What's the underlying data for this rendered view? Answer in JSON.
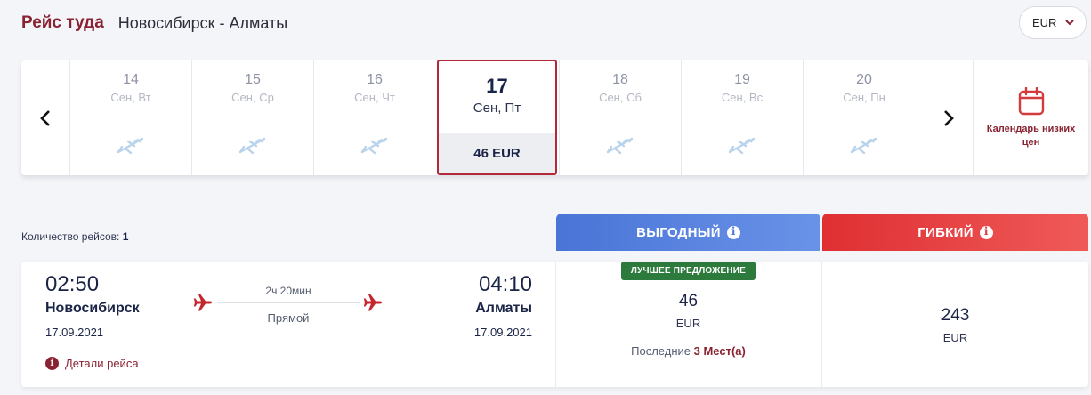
{
  "header": {
    "direction": "Рейс туда",
    "route": "Новосибирск - Алматы"
  },
  "currency": {
    "selected": "EUR",
    "icon": "chevron-down-icon"
  },
  "date_bar": {
    "prev_icon": "chevron-left-icon",
    "next_icon": "chevron-right-icon",
    "days": [
      {
        "num": "14",
        "weekday": "Сен, Вт",
        "price": null,
        "selected": false
      },
      {
        "num": "15",
        "weekday": "Сен, Ср",
        "price": null,
        "selected": false
      },
      {
        "num": "16",
        "weekday": "Сен, Чт",
        "price": null,
        "selected": false
      },
      {
        "num": "17",
        "weekday": "Сен, Пт",
        "price": "46 EUR",
        "selected": true
      },
      {
        "num": "18",
        "weekday": "Сен, Сб",
        "price": null,
        "selected": false
      },
      {
        "num": "19",
        "weekday": "Сен, Вс",
        "price": null,
        "selected": false
      },
      {
        "num": "20",
        "weekday": "Сен, Пн",
        "price": null,
        "selected": false
      }
    ],
    "low_price_calendar": {
      "label": "Календарь низких цен",
      "icon": "calendar-icon"
    }
  },
  "flights_count": {
    "label": "Количество рейсов:",
    "value": "1"
  },
  "fares": {
    "economy": {
      "label": "ВЫГОДНЫЙ",
      "color": "#4f79d9"
    },
    "flexible": {
      "label": "ГИБКИЙ",
      "color": "#e23b3c"
    }
  },
  "flight": {
    "departure": {
      "time": "02:50",
      "city": "Новосибирск",
      "date": "17.09.2021"
    },
    "arrival": {
      "time": "04:10",
      "city": "Алматы",
      "date": "17.09.2021"
    },
    "duration": "2ч 20мин",
    "type": "Прямой",
    "details_label": "Детали рейса",
    "economy_offer": {
      "badge": "ЛУЧШЕЕ ПРЕДЛОЖЕНИЕ",
      "price": "46",
      "currency": "EUR",
      "seats_prefix": "Последние",
      "seats_value": "3 Мест(а)"
    },
    "flexible_offer": {
      "price": "243",
      "currency": "EUR"
    }
  }
}
